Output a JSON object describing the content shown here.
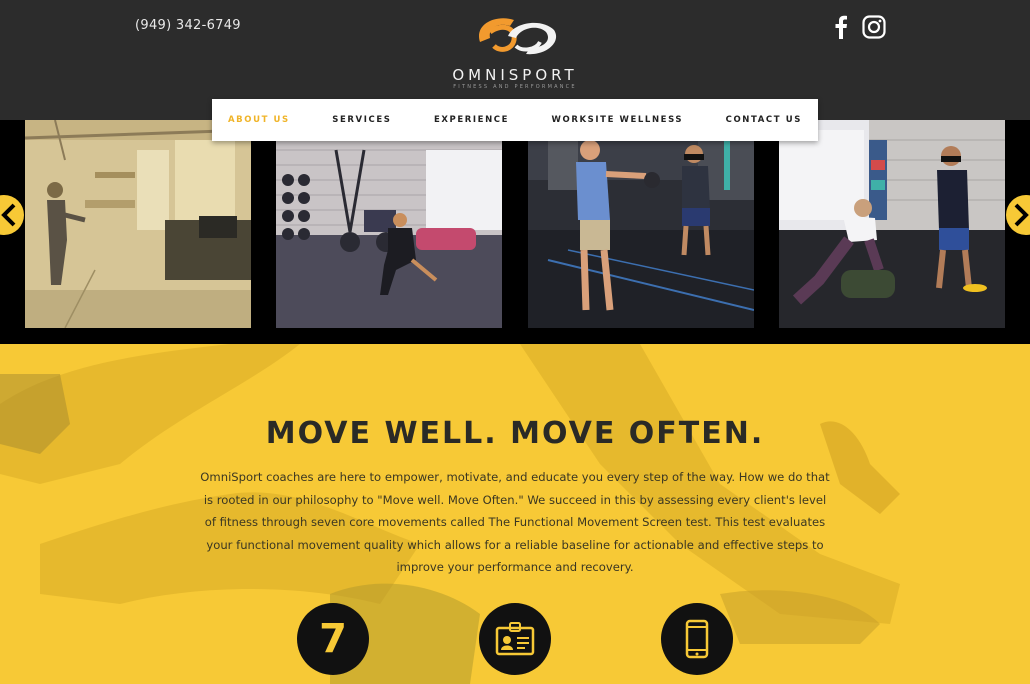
{
  "header": {
    "phone": "(949) 342-6749",
    "logo_name": "OMNISPORT",
    "logo_tagline": "FITNESS AND PERFORMANCE",
    "social": [
      {
        "icon": "facebook-icon"
      },
      {
        "icon": "instagram-icon"
      }
    ]
  },
  "nav": {
    "items": [
      {
        "label": "ABOUT US",
        "active": true
      },
      {
        "label": "SERVICES",
        "active": false
      },
      {
        "label": "EXPERIENCE",
        "active": false
      },
      {
        "label": "WORKSITE WELLNESS",
        "active": false
      },
      {
        "label": "CONTACT US",
        "active": false
      }
    ]
  },
  "gallery": {
    "prev_icon": "chevron-left-icon",
    "next_icon": "chevron-right-icon"
  },
  "hero": {
    "headline": "MOVE WELL. MOVE OFTEN.",
    "body": "OmniSport coaches are here to empower, motivate, and educate you every step of the way. How we do that is rooted in our philosophy to \"Move well. Move Often.\" We succeed in this by assessing every client's level of fitness through seven core movements called The Functional Movement Screen test. This test evaluates your functional movement quality which allows for a reliable baseline for actionable and effective steps to improve your performance and recovery.",
    "icons": [
      {
        "icon": "number-seven-icon",
        "text": "7"
      },
      {
        "icon": "id-badge-icon"
      },
      {
        "icon": "smartphone-icon"
      }
    ]
  },
  "colors": {
    "accent": "#f0b429",
    "hero_bg": "#f7c936",
    "header_bg": "#2c2c2c",
    "logo_orange": "#f29a2e"
  }
}
